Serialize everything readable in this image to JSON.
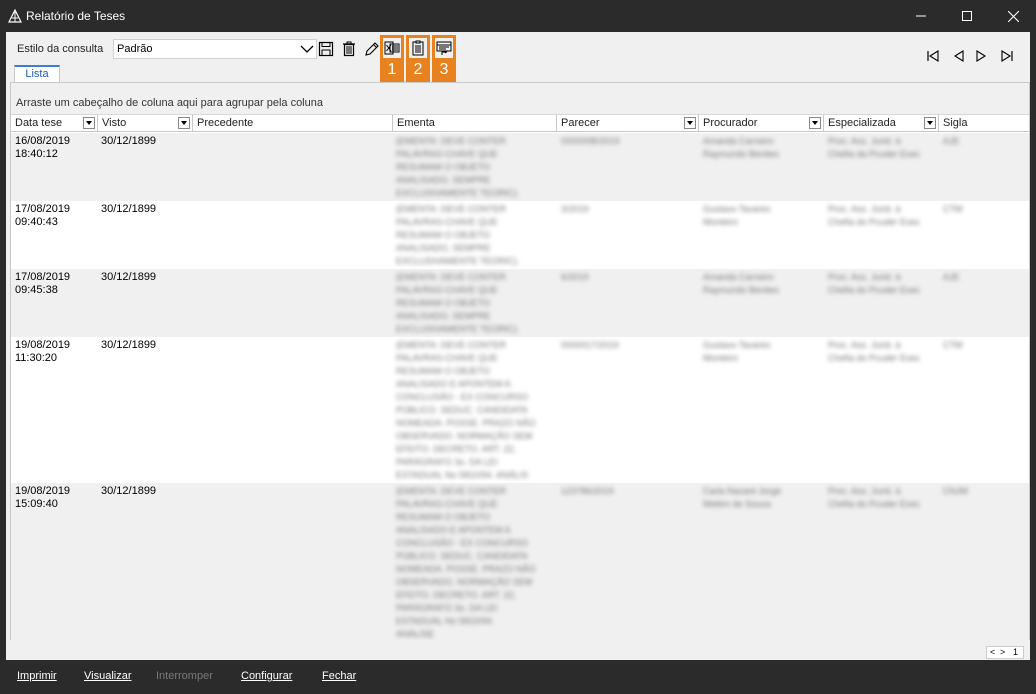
{
  "window": {
    "title": "Relatório de Teses"
  },
  "toolbar": {
    "style_label": "Estilo da consulta",
    "style_value": "Padrão",
    "highlight_numbers": [
      "1",
      "2",
      "3"
    ],
    "highlight_color": "#e8821e"
  },
  "tabs": [
    {
      "label": "Lista"
    }
  ],
  "grid": {
    "group_hint": "Arraste um cabeçalho de coluna aqui para agrupar pela coluna",
    "columns": [
      "Data tese",
      "Visto",
      "Precedente",
      "Ementa",
      "Parecer",
      "Procurador",
      "Especializada",
      "Sigla"
    ],
    "rows": [
      {
        "data_tese": "16/08/2019\n18:40:12",
        "visto": "30/12/1899",
        "ementa": " (EMENTA: DEVE CONTER\nPALAVRAS-CHAVE QUE\nRESUMAM O OBJETO\nANALISADO, SEMPRE\nEXCLUSIVAMENTE TEORIC).",
        "parecer": "000000B/2019",
        "procurador": "Amanda Carneiro\nRaymundo Benites",
        "especializada": "Proc. Ass. Jurid. à\nChefia da Pcuder Exec",
        "sigla": "AJE"
      },
      {
        "data_tese": "17/08/2019\n09:40:43",
        "visto": "30/12/1899",
        "ementa": " (EMENTA: DEVE CONTER\nPALAVRAS-CHAVE QUE\nRESUMAM O OBJETO\nANALISADO, SEMPRE\nEXCLUSIVAMENTE TEORIC).",
        "parecer": "3/2019",
        "procurador": "Gustavo Tavares\nMonteiro",
        "especializada": "Proc. Ass. Jurid. à\nChefia do Pcuder Exec",
        "sigla": "CTM"
      },
      {
        "data_tese": "17/08/2019\n09:45:38",
        "visto": "30/12/1899",
        "ementa": " (EMENTA: DEVE CONTER\nPALAVRAS-CHAVE QUE\nRESUMAM O OBJETO\nANALISADO, SEMPRE\nEXCLUSIVAMENTE TEORIC).",
        "parecer": "6/2019",
        "procurador": "Amanda Carneiro\nRaymundo Benites",
        "especializada": "Proc. Ass. Jurid. à\nChefia do Pcuder Exec",
        "sigla": "AJE"
      },
      {
        "data_tese": "19/08/2019\n11:30:20",
        "visto": "30/12/1899",
        "ementa": " (EMENTA: DEVE CONTER\nPALAVRAS-CHAVE QUE\nRESUMAM O OBJETO\nANALISADO E APONTEM A\nCONCLUSÃO - EX CONCURSO\nPÚBLICO. SEDUC. CANDIDATA\nNOMEADA. POSSE. PRAZO NÃO\nOBSERVADO. NORMAÇÃO SEM\nEFEITO. DECRETO. ART. 22,\nPARÁGRAFO 3o. DA LEI\nESTADUAL No 5810/94. ANÁLIS",
        "parecer": "0000017/2019",
        "procurador": "Gustavo Tavares\nMonteiro",
        "especializada": "Proc. Ass. Jurid. à\nChefia do Pcuder Exec",
        "sigla": "CTM"
      },
      {
        "data_tese": "19/08/2019\n15:09:40",
        "visto": "30/12/1899",
        "ementa": " (EMENTA: DEVE CONTER\nPALAVRAS-CHAVE QUE\nRESUMAM O OBJETO\nANALISADO E APONTEM A\nCONCLUSÃO - EX CONCURSO\nPÚBLICO. SEDUC. CANDIDATA\nNOMEADA. POSSE. PRAZO NÃO\nOBSERVADO. NORMAÇÃO SEM\nEFEITO. DECRETO. ART. 22,\nPARÁGRAFO 3o. DA LEI\nESTADUAL No 5810/94.\nANÁLISE",
        "parecer": "123786/2019",
        "procurador": "Carla Nazaré Jorge\nMelém de Souza",
        "especializada": "Proc. Ass. Jurid. à\nChefia do Pcuder Exec",
        "sigla": "CNJM"
      }
    ],
    "pager_page": "1"
  },
  "footer": {
    "buttons": [
      {
        "label": "Imprimir",
        "enabled": true
      },
      {
        "label": "Visualizar",
        "enabled": true
      },
      {
        "label": "Interromper",
        "enabled": false
      },
      {
        "label": "Configurar",
        "enabled": true
      },
      {
        "label": "Fechar",
        "enabled": true
      }
    ]
  }
}
